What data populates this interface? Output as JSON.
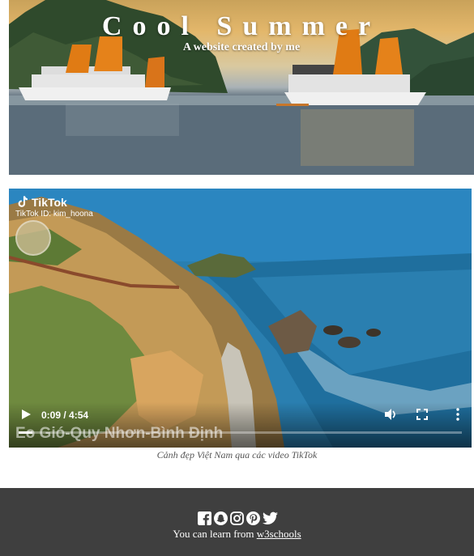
{
  "hero": {
    "title": "Cool Summer",
    "subtitle": "A website created by me"
  },
  "video": {
    "tiktok_brand": "TikTok",
    "tiktok_id": "TikTok ID: kim_hoona",
    "overlay_caption": "Eo Gió-Quy Nhơn-Bình Định",
    "current_time": "0:09",
    "duration": "4:54",
    "time_display": "0:09 / 4:54",
    "progress_fraction": 0.031,
    "icons": [
      "play-icon",
      "volume-icon",
      "fullscreen-icon",
      "more-options-icon"
    ]
  },
  "caption": "Cảnh đẹp Việt Nam qua các video TikTok",
  "footer": {
    "social_icons": [
      "facebook-icon",
      "snapchat-icon",
      "instagram-icon",
      "pinterest-icon",
      "twitter-icon"
    ],
    "text_prefix": "You can learn from ",
    "link_text": "w3schools"
  },
  "colors": {
    "footer_bg": "#3f3f3f",
    "caption_text": "#555555"
  }
}
